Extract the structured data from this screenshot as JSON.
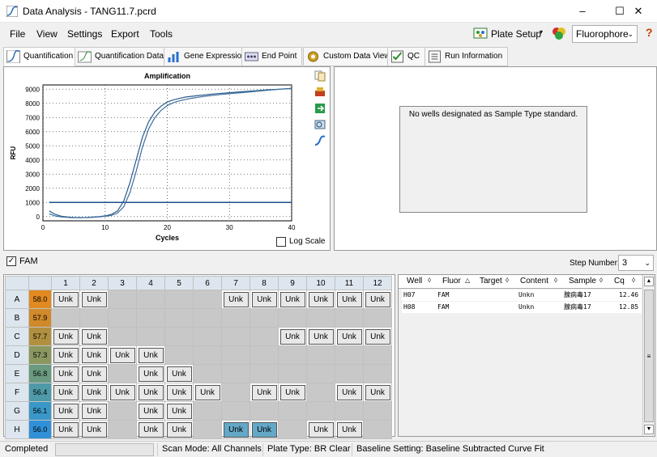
{
  "window": {
    "title": "Data Analysis - TANG11.7.pcrd",
    "minimize": "–",
    "maximize": "☐",
    "close": "✕"
  },
  "menu": [
    "File",
    "View",
    "Settings",
    "Export",
    "Tools"
  ],
  "toolbar": {
    "plate_setup": "Plate Setup",
    "fluorophore": "Fluorophore",
    "help": "?"
  },
  "tabs": [
    "Quantification",
    "Quantification Data",
    "Gene Expression",
    "End Point",
    "Custom Data View",
    "QC",
    "Run Information"
  ],
  "chart_data": {
    "type": "line",
    "title": "Amplification",
    "xlabel": "Cycles",
    "ylabel": "RFU",
    "xlim": [
      0,
      40
    ],
    "ylim": [
      -300,
      9300
    ],
    "xticks": [
      0,
      10,
      20,
      30,
      40
    ],
    "yticks": [
      0,
      1000,
      2000,
      3000,
      4000,
      5000,
      6000,
      7000,
      8000,
      9000
    ],
    "grid": true,
    "threshold": 1000,
    "series": [
      {
        "x": [
          1,
          2,
          3,
          4,
          5,
          6,
          7,
          8,
          9,
          10,
          11,
          12,
          13,
          14,
          15,
          16,
          17,
          18,
          19,
          20,
          21,
          22,
          23,
          24,
          25,
          26,
          28,
          30,
          32,
          34,
          36,
          38,
          40
        ],
        "values": [
          400,
          150,
          20,
          -30,
          -60,
          -70,
          -60,
          -40,
          0,
          50,
          150,
          400,
          1100,
          2400,
          4000,
          5600,
          6700,
          7400,
          7800,
          8100,
          8250,
          8350,
          8450,
          8500,
          8550,
          8600,
          8680,
          8750,
          8820,
          8880,
          8950,
          9000,
          9050
        ]
      },
      {
        "x": [
          1,
          2,
          3,
          4,
          5,
          6,
          7,
          8,
          9,
          10,
          11,
          12,
          13,
          14,
          15,
          16,
          17,
          18,
          19,
          20,
          21,
          22,
          23,
          24,
          25,
          26,
          28,
          30,
          32,
          34,
          36,
          38,
          40
        ],
        "values": [
          200,
          40,
          -20,
          -60,
          -80,
          -80,
          -70,
          -50,
          -20,
          20,
          80,
          250,
          700,
          1700,
          3200,
          4900,
          6200,
          7000,
          7500,
          7850,
          8050,
          8180,
          8280,
          8360,
          8430,
          8500,
          8600,
          8680,
          8760,
          8840,
          8920,
          8990,
          9060
        ]
      }
    ]
  },
  "log_scale": "Log Scale",
  "no_standard": "No wells designated as Sample Type standard.",
  "fam_label": "FAM",
  "step_number": {
    "label": "Step Number:",
    "value": "3"
  },
  "plate": {
    "columns": [
      "1",
      "2",
      "3",
      "4",
      "5",
      "6",
      "7",
      "8",
      "9",
      "10",
      "11",
      "12"
    ],
    "rows": [
      {
        "label": "A",
        "temp": "58.0",
        "color": "#e08a20",
        "wells": [
          1,
          1,
          0,
          0,
          0,
          0,
          1,
          1,
          1,
          1,
          1,
          1
        ]
      },
      {
        "label": "B",
        "temp": "57.9",
        "color": "#d08a2a",
        "wells": [
          0,
          0,
          0,
          0,
          0,
          0,
          0,
          0,
          0,
          0,
          0,
          0
        ]
      },
      {
        "label": "C",
        "temp": "57.7",
        "color": "#b09040",
        "wells": [
          1,
          1,
          0,
          0,
          0,
          0,
          0,
          0,
          1,
          1,
          1,
          1
        ]
      },
      {
        "label": "D",
        "temp": "57.3",
        "color": "#8a9860",
        "wells": [
          1,
          1,
          1,
          1,
          0,
          0,
          0,
          0,
          0,
          0,
          0,
          0
        ]
      },
      {
        "label": "E",
        "temp": "56.8",
        "color": "#6a9a80",
        "wells": [
          1,
          1,
          0,
          1,
          1,
          0,
          0,
          0,
          0,
          0,
          0,
          0
        ]
      },
      {
        "label": "F",
        "temp": "56.4",
        "color": "#4e9aa8",
        "wells": [
          1,
          1,
          1,
          1,
          1,
          1,
          0,
          1,
          1,
          0,
          1,
          1
        ]
      },
      {
        "label": "G",
        "temp": "56.1",
        "color": "#3a98c8",
        "wells": [
          1,
          1,
          0,
          1,
          1,
          0,
          0,
          0,
          0,
          0,
          0,
          0
        ]
      },
      {
        "label": "H",
        "temp": "56.0",
        "color": "#3090d8",
        "wells": [
          1,
          1,
          0,
          1,
          1,
          0,
          2,
          2,
          0,
          1,
          1,
          0
        ]
      }
    ],
    "unk": "Unk"
  },
  "well_table": {
    "headers": [
      "Well",
      "Fluor",
      "Target",
      "Content",
      "Sample",
      "Cq"
    ],
    "rows": [
      {
        "well": "H07",
        "fluor": "FAM",
        "target": "",
        "content": "Unkn",
        "sample": "腺病毒17",
        "cq": "12.46"
      },
      {
        "well": "H08",
        "fluor": "FAM",
        "target": "",
        "content": "Unkn",
        "sample": "腺病毒17",
        "cq": "12.85"
      }
    ]
  },
  "status": {
    "state": "Completed",
    "scan": "Scan Mode: All Channels",
    "plate_type": "Plate Type: BR Clear",
    "baseline": "Baseline Setting: Baseline Subtracted Curve Fit"
  }
}
